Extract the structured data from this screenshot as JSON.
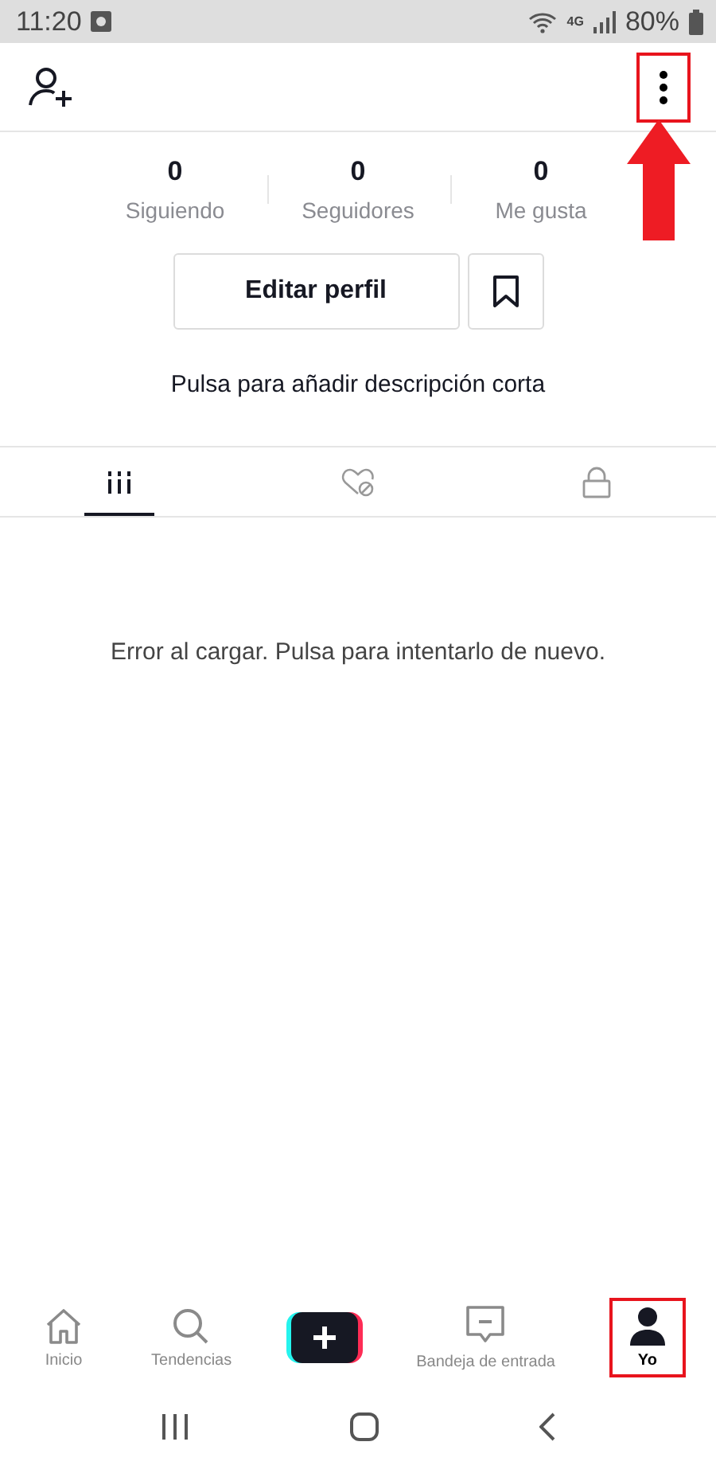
{
  "status_bar": {
    "time": "11:20",
    "network": "4G",
    "battery": "80%"
  },
  "header": {
    "menu_highlighted": true,
    "pointer_arrow": true
  },
  "stats": [
    {
      "value": "0",
      "label": "Siguiendo"
    },
    {
      "value": "0",
      "label": "Seguidores"
    },
    {
      "value": "0",
      "label": "Me gusta"
    }
  ],
  "edit_button": "Editar perfil",
  "description_prompt": "Pulsa para añadir descripción corta",
  "tabs": [
    {
      "kind": "videos",
      "selected": true
    },
    {
      "kind": "liked",
      "selected": false
    },
    {
      "kind": "private",
      "selected": false
    }
  ],
  "error_message": "Error al cargar. Pulsa para intentarlo de nuevo.",
  "bottom_nav": [
    {
      "kind": "home",
      "label": "Inicio",
      "selected": false,
      "highlighted": false
    },
    {
      "kind": "search",
      "label": "Tendencias",
      "selected": false,
      "highlighted": false
    },
    {
      "kind": "create",
      "selected": false,
      "highlighted": false
    },
    {
      "kind": "inbox",
      "label": "Bandeja de entrada",
      "selected": false,
      "highlighted": false
    },
    {
      "kind": "profile",
      "label": "Yo",
      "selected": true,
      "highlighted": true
    }
  ]
}
